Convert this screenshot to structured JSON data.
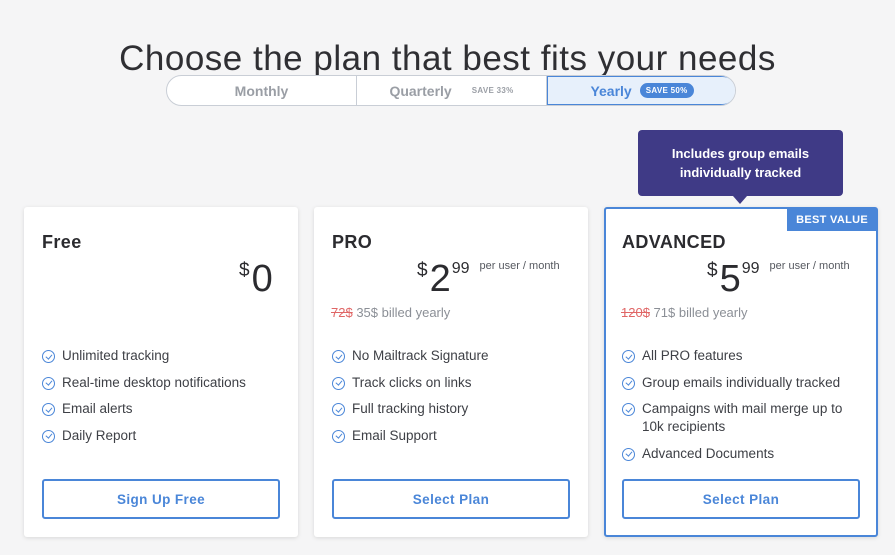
{
  "header": {
    "title": "Choose the plan that best fits your needs"
  },
  "billing_tabs": [
    {
      "label": "Monthly",
      "save": ""
    },
    {
      "label": "Quarterly",
      "save": "SAVE 33%"
    },
    {
      "label": "Yearly",
      "save": "SAVE 50%",
      "active": true
    }
  ],
  "tooltip": {
    "text": "Includes group emails individually tracked"
  },
  "colors": {
    "accent": "#4a86d8",
    "tooltip_bg": "#3f3a86",
    "strike": "#e06666"
  },
  "plans": [
    {
      "name": "Free",
      "currency": "$",
      "price": "0",
      "cents": "",
      "per": "",
      "old_price": "",
      "billed": "",
      "features": [
        "Unlimited tracking",
        "Real-time desktop notifications",
        "Email alerts",
        "Daily Report"
      ],
      "button": "Sign Up Free"
    },
    {
      "name": "PRO",
      "currency": "$",
      "price": "2",
      "cents": "99",
      "per": "per user / month",
      "old_price": "72$",
      "billed": "35$ billed yearly",
      "features": [
        "No Mailtrack Signature",
        "Track clicks on links",
        "Full tracking history",
        "Email Support"
      ],
      "button": "Select Plan"
    },
    {
      "name": "ADVANCED",
      "badge": "BEST VALUE",
      "currency": "$",
      "price": "5",
      "cents": "99",
      "per": "per user / month",
      "old_price": "120$",
      "billed": "71$ billed yearly",
      "features": [
        "All PRO features",
        "Group emails individually tracked",
        "Campaigns with mail merge up to 10k recipients",
        "Advanced Documents"
      ],
      "button": "Select Plan"
    }
  ]
}
